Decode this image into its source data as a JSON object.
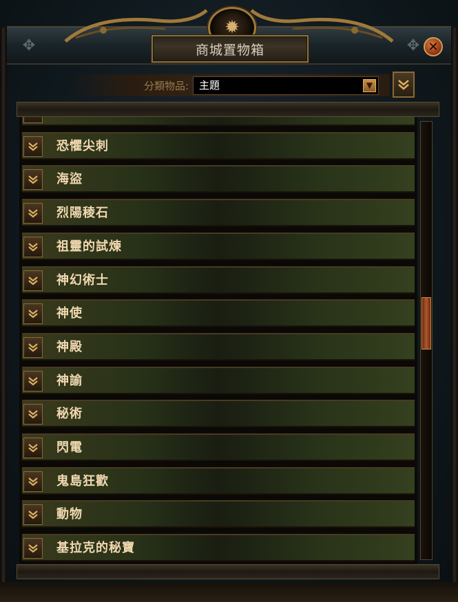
{
  "window": {
    "title": "商城置物箱",
    "close_icon": "close-icon",
    "crest_icon": "beast-crest-icon"
  },
  "filter": {
    "label": "分類物品:",
    "selected": "主題",
    "dropdown_icon": "chevron-down-icon",
    "sort_icon": "chevron-down-icon"
  },
  "list": {
    "items": [
      {
        "label": ""
      },
      {
        "label": "恐懼尖刺"
      },
      {
        "label": "海盜"
      },
      {
        "label": "烈陽稜石"
      },
      {
        "label": "祖靈的試煉"
      },
      {
        "label": "神幻術士"
      },
      {
        "label": "神使"
      },
      {
        "label": "神殿"
      },
      {
        "label": "神諭"
      },
      {
        "label": "秘術"
      },
      {
        "label": "閃電"
      },
      {
        "label": "鬼島狂歡"
      },
      {
        "label": "動物"
      },
      {
        "label": "基拉克的秘寶"
      }
    ],
    "scroll_position": 0.4
  },
  "colors": {
    "accent": "#c89048",
    "item_text": "#f0d8b0",
    "scrollbar_thumb": "#b0582a"
  }
}
